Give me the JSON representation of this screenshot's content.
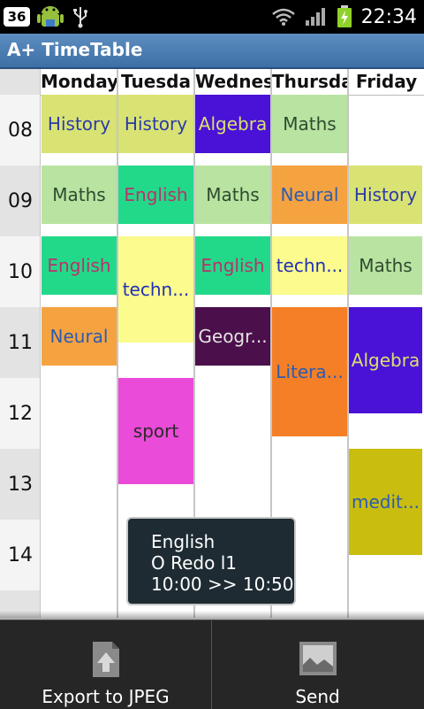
{
  "status_bar": {
    "notification_count": "36",
    "time": "22:34",
    "icons": [
      "android-debug-icon",
      "usb-icon",
      "wifi-icon",
      "signal-icon",
      "battery-charging-icon"
    ]
  },
  "app": {
    "title": "A+ TimeTable"
  },
  "days": [
    "Monday",
    "Tuesda",
    "Wednes",
    "Thursda",
    "Friday"
  ],
  "hours": [
    "08",
    "09",
    "10",
    "11",
    "12",
    "13",
    "14"
  ],
  "events": [
    {
      "label": "History",
      "bg": "#d9e373",
      "fg": "#2b3aa8"
    },
    {
      "label": "Maths",
      "bg": "#b8e3a1",
      "fg": "#2f4a2f"
    },
    {
      "label": "English",
      "bg": "#22d98a",
      "fg": "#b8336a"
    },
    {
      "label": "Neural",
      "bg": "#f5a341",
      "fg": "#2d5cb0"
    },
    {
      "label": "History",
      "bg": "#d9e373",
      "fg": "#2b3aa8"
    },
    {
      "label": "English",
      "bg": "#22d98a",
      "fg": "#b8336a"
    },
    {
      "label": "techn...",
      "bg": "#fbfb8e",
      "fg": "#2230b5"
    },
    {
      "label": "sport",
      "bg": "#ea4bd8",
      "fg": "#2a2a2a"
    },
    {
      "label": "Algebra",
      "bg": "#4a12d6",
      "fg": "#d8e070"
    },
    {
      "label": "Maths",
      "bg": "#b8e3a1",
      "fg": "#2f4a2f"
    },
    {
      "label": "English",
      "bg": "#22d98a",
      "fg": "#b8336a"
    },
    {
      "label": "Geogr...",
      "bg": "#4b0f4b",
      "fg": "#e2e2e2"
    },
    {
      "label": "Maths",
      "bg": "#b8e3a1",
      "fg": "#2f4a2f"
    },
    {
      "label": "Neural",
      "bg": "#f5a341",
      "fg": "#2d5cb0"
    },
    {
      "label": "techn...",
      "bg": "#fbfb8e",
      "fg": "#2230b5"
    },
    {
      "label": "Litera...",
      "bg": "#f57f26",
      "fg": "#2d5cb0"
    },
    {
      "label": "History",
      "bg": "#d9e373",
      "fg": "#2b3aa8"
    },
    {
      "label": "Maths",
      "bg": "#b8e3a1",
      "fg": "#2f4a2f"
    },
    {
      "label": "Algebra",
      "bg": "#4a12d6",
      "fg": "#d8e070"
    },
    {
      "label": "medit...",
      "bg": "#c9bd10",
      "fg": "#2d5cb0"
    }
  ],
  "toast": {
    "subject": "English",
    "room": "O Redo l1",
    "time_range": "10:00 >> 10:50"
  },
  "toolbar": {
    "export_label": "Export to JPEG",
    "send_label": "Send"
  }
}
